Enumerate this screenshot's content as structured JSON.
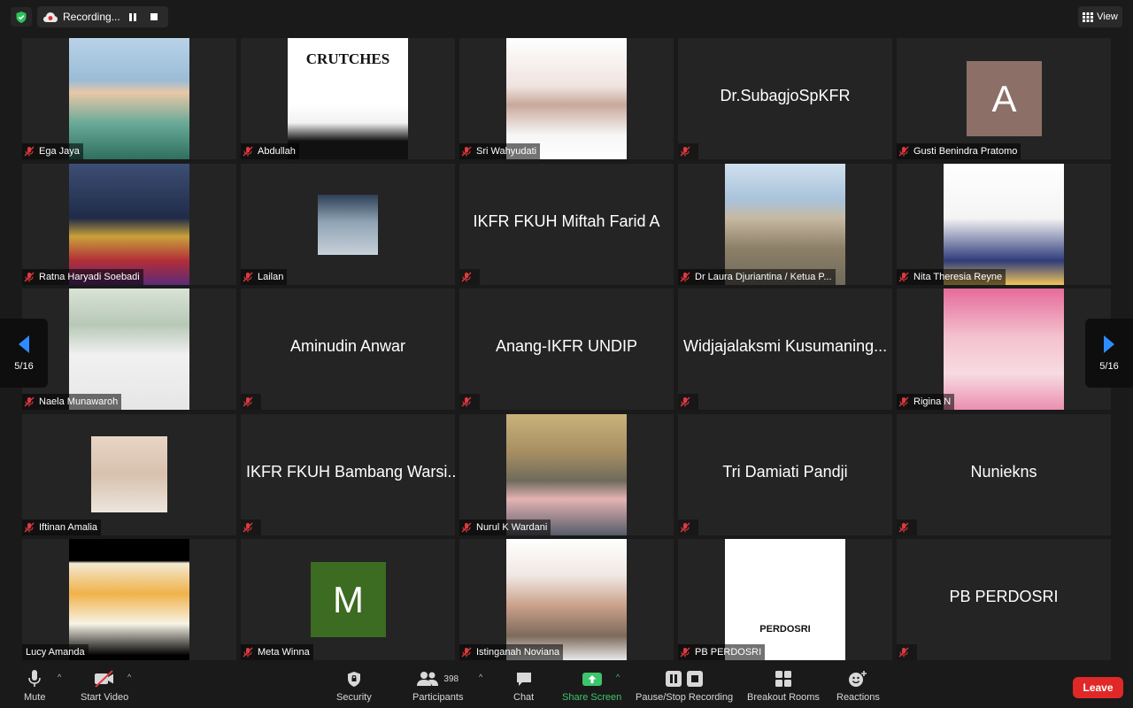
{
  "top_bar": {
    "recording_label": "Recording...",
    "view_label": "View",
    "icons": [
      "shield-check-icon",
      "cloud-record-icon",
      "pause-icon",
      "stop-icon",
      "grid-view-icon"
    ]
  },
  "pagination": {
    "left_label": "5/16",
    "right_label": "5/16"
  },
  "tiles": [
    {
      "name": "Ega Jaya",
      "kind": "video",
      "muted": true
    },
    {
      "name": "Abdullah",
      "kind": "video",
      "muted": true,
      "image_text": "CRUTCHES"
    },
    {
      "name": "Sri Wahyudati",
      "kind": "video",
      "muted": true
    },
    {
      "name": "",
      "kind": "name",
      "center": "Dr.SubagjoSpKFR",
      "muted": true
    },
    {
      "name": "Gusti Benindra Pratomo",
      "kind": "avatar",
      "initial": "A",
      "avatar_color": "#8c6f66",
      "muted": true
    },
    {
      "name": "Ratna Haryadi Soebadi",
      "kind": "video",
      "muted": true
    },
    {
      "name": "Lailan",
      "kind": "smallvideo",
      "muted": true
    },
    {
      "name": "",
      "kind": "name",
      "center": "IKFR FKUH Miftah Farid A",
      "muted": true
    },
    {
      "name": "Dr Laura Djuriantina / Ketua P...",
      "kind": "video",
      "muted": true
    },
    {
      "name": "Nita Theresia Reyne",
      "kind": "video",
      "muted": true
    },
    {
      "name": "Naela Munawaroh",
      "kind": "video",
      "muted": true
    },
    {
      "name": "",
      "kind": "name",
      "center": "Aminudin Anwar",
      "muted": true
    },
    {
      "name": "",
      "kind": "name",
      "center": "Anang-IKFR UNDIP",
      "muted": true
    },
    {
      "name": "",
      "kind": "name",
      "center": "Widjajalaksmi Kusumaning...",
      "muted": true
    },
    {
      "name": "Rigina N",
      "kind": "video",
      "muted": true
    },
    {
      "name": "Iftinan Amalia",
      "kind": "smallvideo",
      "muted": true
    },
    {
      "name": "",
      "kind": "name",
      "center": "IKFR FKUH Bambang Warsi...",
      "muted": true
    },
    {
      "name": "Nurul K Wardani",
      "kind": "video",
      "muted": true
    },
    {
      "name": "",
      "kind": "name",
      "center": "Tri Damiati Pandji",
      "muted": true
    },
    {
      "name": "",
      "kind": "name",
      "center": "Nuniekns",
      "muted": true
    },
    {
      "name": "Lucy Amanda",
      "kind": "video",
      "muted": false
    },
    {
      "name": "Meta Winna",
      "kind": "avatar",
      "initial": "M",
      "avatar_color": "#3c6b22",
      "muted": true
    },
    {
      "name": "Istinganah Noviana",
      "kind": "video",
      "muted": true
    },
    {
      "name": "PB PERDOSRI",
      "kind": "video",
      "muted": true,
      "image_text": "PERDOSRI"
    },
    {
      "name": "",
      "kind": "name",
      "center": "PB PERDOSRI",
      "muted": true
    }
  ],
  "toolbar": {
    "mute": "Mute",
    "start_video": "Start Video",
    "security": "Security",
    "participants": "Participants",
    "participant_count": "398",
    "chat": "Chat",
    "share_screen": "Share Screen",
    "pause_stop_recording": "Pause/Stop Recording",
    "breakout_rooms": "Breakout Rooms",
    "reactions": "Reactions",
    "leave": "Leave"
  },
  "colors": {
    "background": "#1a1a1a",
    "tile": "#242424",
    "accent_green": "#3ec46d",
    "leave_red": "#e02828",
    "arrow_blue": "#2d8cff",
    "muted_red": "#e0393e"
  }
}
